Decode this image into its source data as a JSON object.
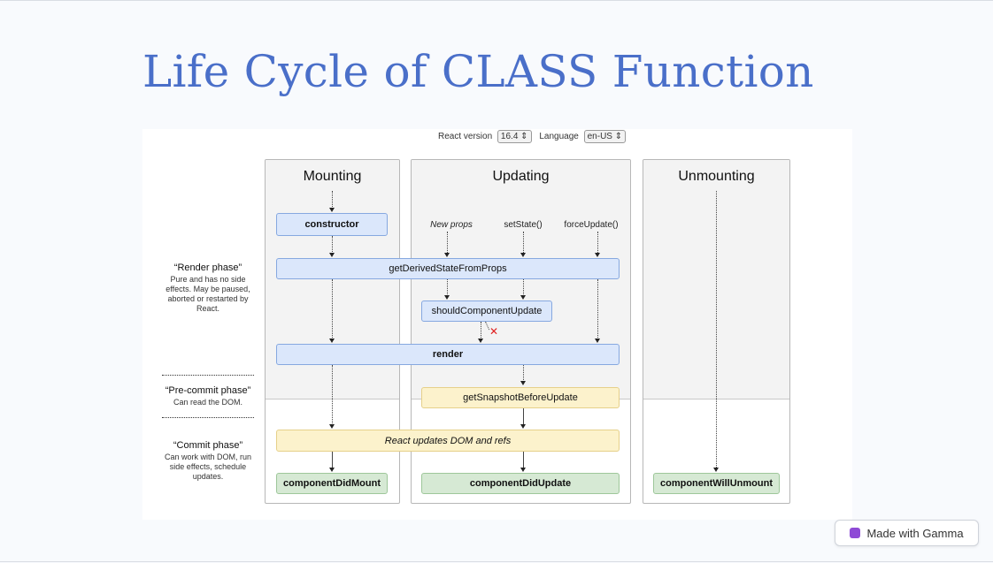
{
  "slide": {
    "title": "Life Cycle of CLASS Function",
    "badge": "Made with Gamma"
  },
  "controls": {
    "react_version_label": "React version",
    "react_version_value": "16.4 ⇕",
    "language_label": "Language",
    "language_value": "en-US ⇕"
  },
  "columns": {
    "mounting": "Mounting",
    "updating": "Updating",
    "unmounting": "Unmounting"
  },
  "triggers": {
    "new_props": "New props",
    "set_state": "setState()",
    "force_update": "forceUpdate()"
  },
  "methods": {
    "constructor": "constructor",
    "get_derived_state": "getDerivedStateFromProps",
    "should_update": "shouldComponentUpdate",
    "render": "render",
    "get_snapshot": "getSnapshotBeforeUpdate",
    "dom_update": "React updates DOM and refs",
    "did_mount": "componentDidMount",
    "did_update": "componentDidUpdate",
    "will_unmount": "componentWillUnmount"
  },
  "phases": {
    "render_title": "“Render phase”",
    "render_desc": "Pure and has no side effects. May be paused, aborted or restarted by React.",
    "precommit_title": "“Pre-commit phase”",
    "precommit_desc": "Can read the DOM.",
    "commit_title": "“Commit phase”",
    "commit_desc": "Can work with DOM, run side effects, schedule updates."
  },
  "colors": {
    "title": "#4a6fc9",
    "render_box": "#dbe7fb",
    "precommit_box": "#fcf2cc",
    "commit_box": "#d6e9d4",
    "cancel_mark": "#e02020",
    "gamma_logo": "#8e4ad6"
  },
  "icons": {
    "cancel": "x-mark-icon",
    "gamma": "gamma-logo-icon"
  }
}
